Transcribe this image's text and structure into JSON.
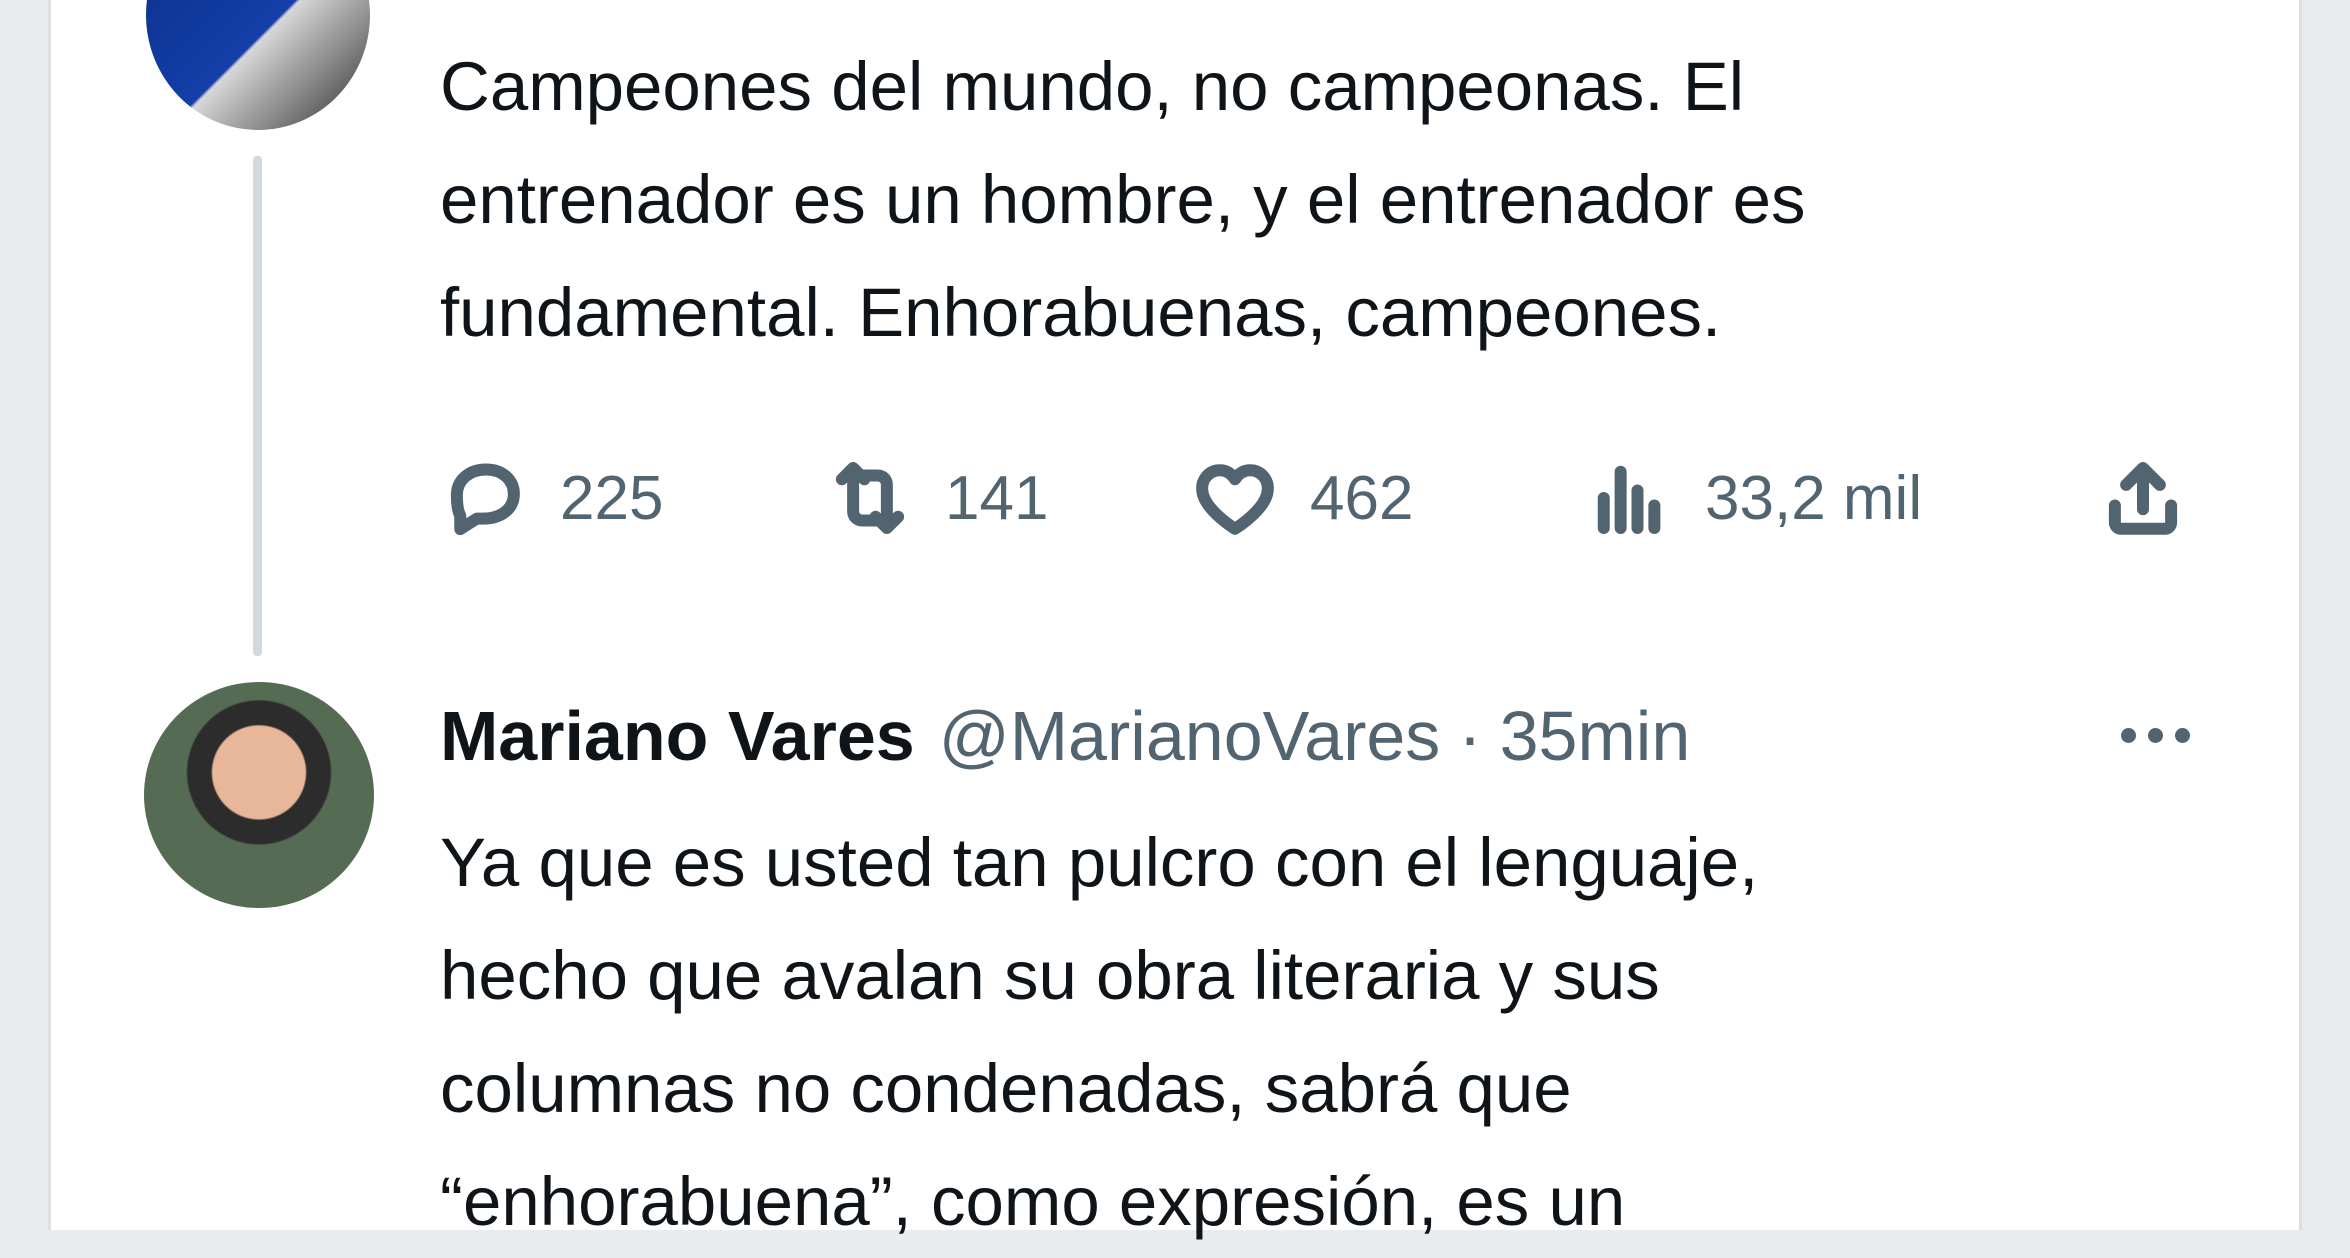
{
  "tweet1": {
    "text": "Campeones del mundo, no campeonas. El\nentrenador es un hombre, y el entrenador es\nfundamental. Enhorabuenas, campeones.",
    "actions": {
      "reply_count": "225",
      "retweet_count": "141",
      "like_count": "462",
      "views_count": "33,2 mil"
    }
  },
  "tweet2": {
    "name": "Mariano Vares",
    "handle": "@MarianoVares",
    "separator": "·",
    "time": "35min",
    "text": "Ya que es usted tan pulcro con el lenguaje,\nhecho que avalan su obra literaria y sus\ncolumnas no condenadas, sabrá que\n“enhorabuena”, como expresión, es un"
  },
  "icons": [
    "reply-icon",
    "retweet-icon",
    "like-icon",
    "views-icon",
    "share-icon",
    "more-icon"
  ],
  "colors": {
    "text": "#0f1419",
    "secondary": "#536471",
    "thread_line": "#cfd9de"
  }
}
